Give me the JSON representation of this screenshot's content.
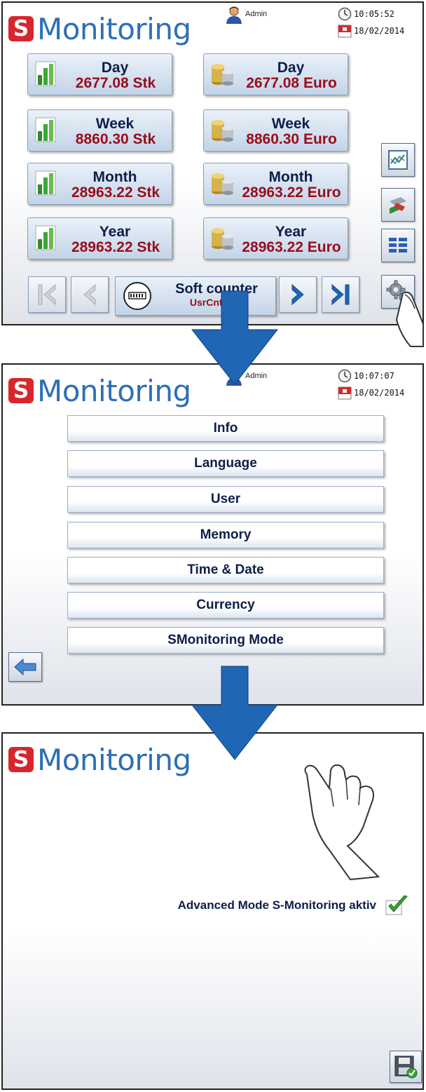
{
  "brand": {
    "initial": "S",
    "name": "Monitoring"
  },
  "screen1": {
    "user": "Admin",
    "time": "10:05:52",
    "date": "18/02/2014",
    "tiles": [
      {
        "label": "Day",
        "value": "2677.08 Stk",
        "icon": "bar-chart-icon"
      },
      {
        "label": "Day",
        "value": "2677.08 Euro",
        "icon": "coins-icon"
      },
      {
        "label": "Week",
        "value": "8860.30 Stk",
        "icon": "bar-chart-icon"
      },
      {
        "label": "Week",
        "value": "8860.30 Euro",
        "icon": "coins-icon"
      },
      {
        "label": "Month",
        "value": "28963.22 Stk",
        "icon": "bar-chart-icon"
      },
      {
        "label": "Month",
        "value": "28963.22 Euro",
        "icon": "coins-icon"
      },
      {
        "label": "Year",
        "value": "28963.22 Stk",
        "icon": "bar-chart-icon"
      },
      {
        "label": "Year",
        "value": "28963.22 Euro",
        "icon": "coins-icon"
      }
    ],
    "counter": {
      "title": "Soft counter",
      "subtitle": "UsrCntr_2T"
    }
  },
  "screen2": {
    "user": "Admin",
    "time": "10:07:07",
    "date": "18/02/2014",
    "menu": [
      "Info",
      "Language",
      "User",
      "Memory",
      "Time & Date",
      "Currency",
      "SMonitoring Mode"
    ]
  },
  "screen3": {
    "status": "Advanced Mode S-Monitoring aktiv"
  },
  "colors": {
    "brand_red": "#d8262c",
    "brand_blue": "#2d6fb6",
    "arrow_blue": "#1f66b5",
    "value_red": "#990d1a"
  }
}
